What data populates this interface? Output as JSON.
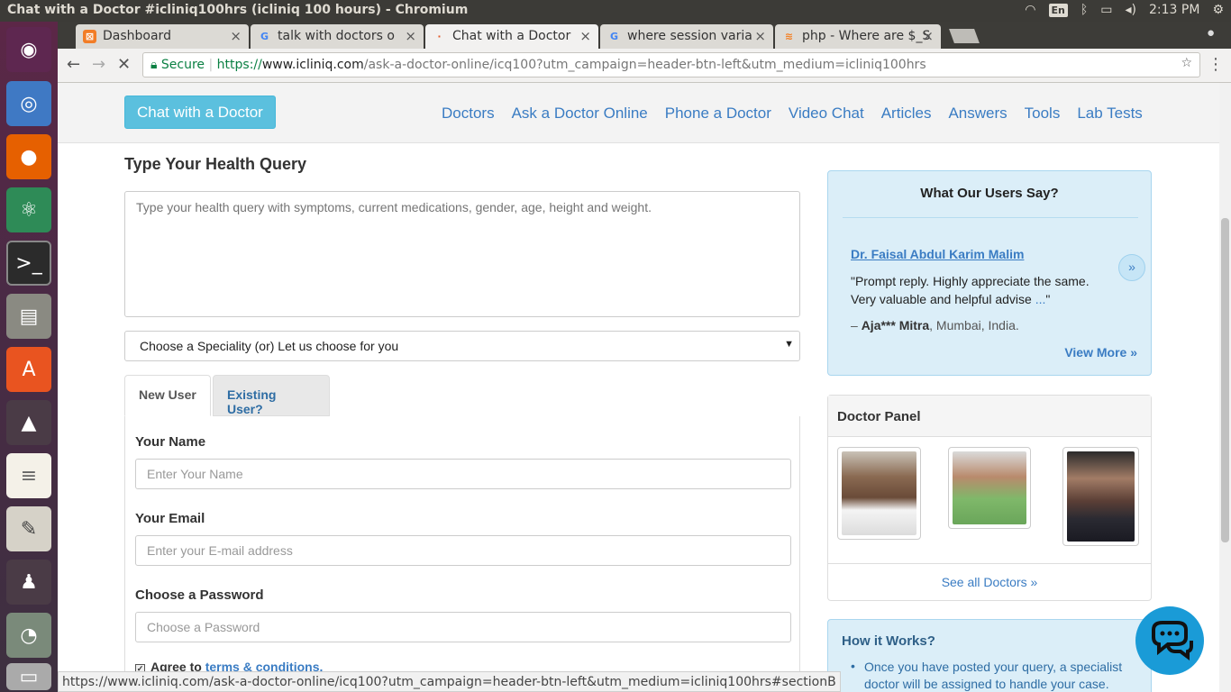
{
  "window": {
    "title": "Chat with a Doctor #icliniq100hrs (icliniq 100 hours) - Chromium",
    "time": "2:13 PM",
    "lang": "En"
  },
  "tabs": [
    {
      "label": "Dashboard",
      "icon": "xampp-icon",
      "color": "#f27d27"
    },
    {
      "label": "talk with doctors o",
      "icon": "google-icon",
      "color": "#4285f4"
    },
    {
      "label": "Chat with a Doctor",
      "icon": "loading-icon",
      "color": "#e25b2b"
    },
    {
      "label": "where session varia",
      "icon": "google-icon",
      "color": "#4285f4"
    },
    {
      "label": "php - Where are $_S",
      "icon": "stackoverflow-icon",
      "color": "#f48024"
    }
  ],
  "url": {
    "secure": "Secure",
    "scheme": "https://",
    "domain": "www.icliniq.com",
    "path": "/ask-a-doctor-online/icq100?utm_campaign=header-btn-left&utm_medium=icliniq100hrs"
  },
  "header": {
    "chat_button": "Chat with a Doctor",
    "nav": [
      "Doctors",
      "Ask a Doctor Online",
      "Phone a Doctor",
      "Video Chat",
      "Articles",
      "Answers",
      "Tools",
      "Lab Tests"
    ]
  },
  "form": {
    "heading": "Type Your Health Query",
    "query_placeholder": "Type your health query with symptoms, current medications, gender, age, height and weight.",
    "speciality": "Choose a Speciality (or) Let us choose for you",
    "tab_new": "New User",
    "tab_existing": "Existing User?",
    "name_label": "Your Name",
    "name_placeholder": "Enter Your Name",
    "email_label": "Your Email",
    "email_placeholder": "Enter your E-mail address",
    "password_label": "Choose a Password",
    "password_placeholder": "Choose a Password",
    "agree_text": "Agree to",
    "agree_link": "terms & conditions."
  },
  "testimonials": {
    "title": "What Our Users Say?",
    "doctor": "Dr. Faisal Abdul Karim Malim",
    "quote": "\"Prompt reply. Highly appreciate the same. Very valuable and helpful advise",
    "more": "...",
    "quote_end": "\"",
    "author": "Aja*** Mitra",
    "location": ", Mumbai, India.",
    "dash": "– ",
    "view_more": "View More »",
    "next": "»"
  },
  "panel": {
    "title": "Doctor Panel",
    "see_all": "See all Doctors »"
  },
  "how": {
    "title": "How it Works?",
    "item": "Once you have posted your query, a specialist doctor will be assigned to handle your case."
  },
  "status_url": "https://www.icliniq.com/ask-a-doctor-online/icq100?utm_campaign=header-btn-left&utm_medium=icliniq100hrs#sectionB"
}
